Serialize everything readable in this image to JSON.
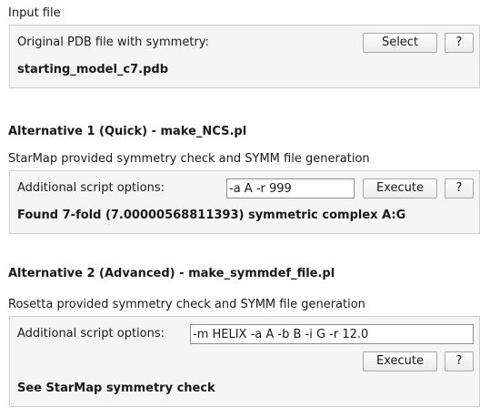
{
  "input_section": {
    "title": "Input file",
    "pdb_label": "Original PDB file with symmetry:",
    "select_button": "Select",
    "help_button": "?",
    "file_name": "starting_model_c7.pdb"
  },
  "alt1": {
    "heading": "Alternative 1 (Quick) - make_NCS.pl",
    "description": "StarMap provided symmetry check and SYMM file generation",
    "options_label": "Additional script options:",
    "options_value": "-a A -r 999",
    "execute_button": "Execute",
    "help_button": "?",
    "result": "Found 7-fold (7.00000568811393) symmetric complex A:G"
  },
  "alt2": {
    "heading": "Alternative 2 (Advanced) - make_symmdef_file.pl",
    "description": "Rosetta provided symmetry check and SYMM file generation",
    "options_label": "Additional script options:",
    "options_value": "-m HELIX -a A -b B -i G -r 12.0",
    "execute_button": "Execute",
    "help_button": "?",
    "result": "See StarMap symmetry check"
  }
}
